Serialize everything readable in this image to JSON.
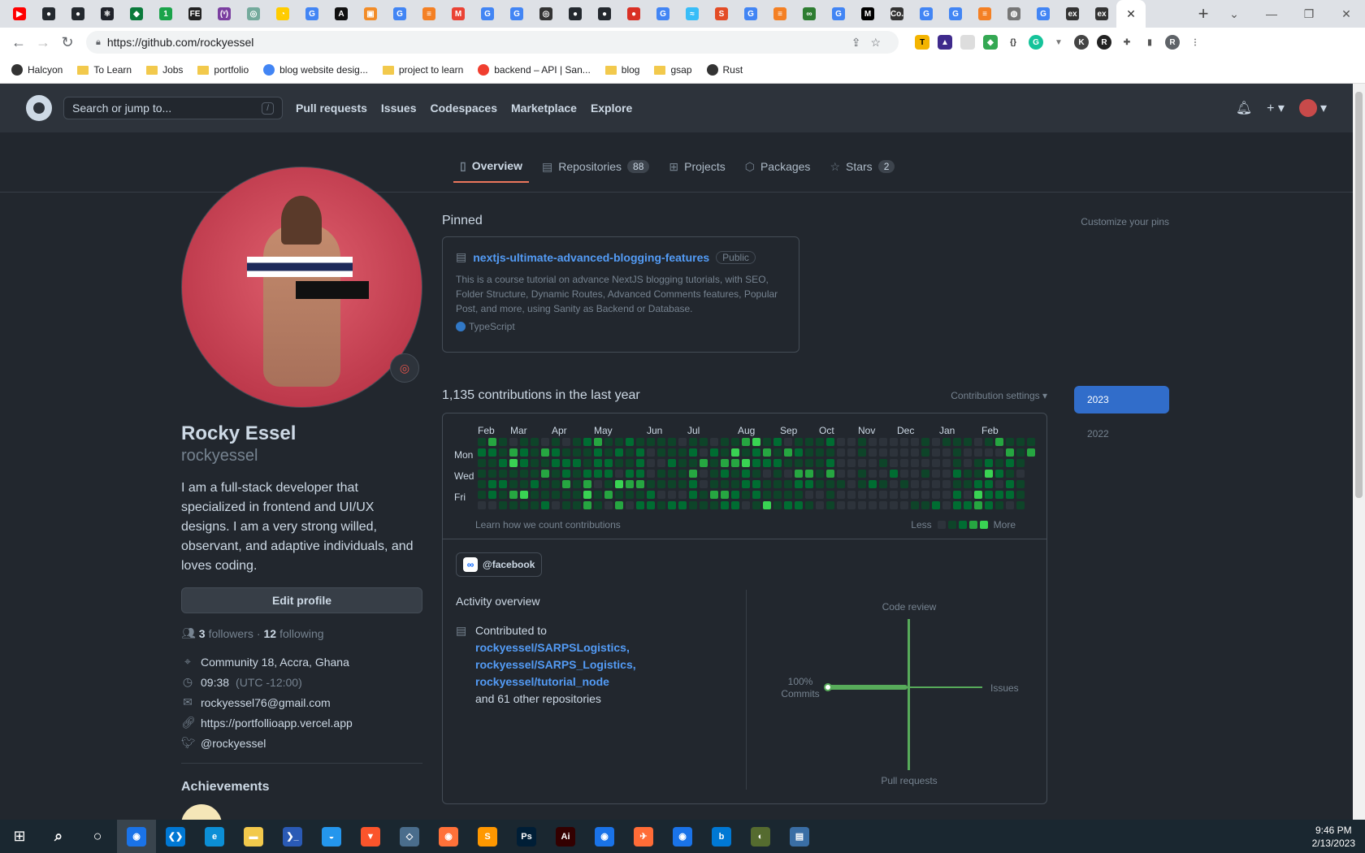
{
  "browser": {
    "url": "https://github.com/rockyessel",
    "tabs": [
      {
        "icon": "youtube-icon",
        "color": "#ff0000",
        "glyph": "▶"
      },
      {
        "icon": "github-icon",
        "color": "#24292f",
        "glyph": "●"
      },
      {
        "icon": "github-icon",
        "color": "#24292f",
        "glyph": "●"
      },
      {
        "icon": "react-icon",
        "color": "#20232a",
        "glyph": "⚛"
      },
      {
        "icon": "leaf-icon",
        "color": "#0b7a3b",
        "glyph": "◆"
      },
      {
        "icon": "one-icon",
        "color": "#1aa34a",
        "glyph": "1"
      },
      {
        "icon": "fe-icon",
        "color": "#222",
        "glyph": "FE"
      },
      {
        "icon": "code-icon",
        "color": "#7b3fa0",
        "glyph": "(ᵛ)"
      },
      {
        "icon": "openai-icon",
        "color": "#74aa9c",
        "glyph": "◎"
      },
      {
        "icon": "pacman-icon",
        "color": "#ffcc00",
        "glyph": "◔"
      },
      {
        "icon": "google-icon",
        "color": "#4285f4",
        "glyph": "G"
      },
      {
        "icon": "a-icon",
        "color": "#111",
        "glyph": "A"
      },
      {
        "icon": "box-icon",
        "color": "#f28c28",
        "glyph": "▣"
      },
      {
        "icon": "google-icon",
        "color": "#4285f4",
        "glyph": "G"
      },
      {
        "icon": "stack-icon",
        "color": "#f48024",
        "glyph": "≡"
      },
      {
        "icon": "gmail-icon",
        "color": "#ea4335",
        "glyph": "M"
      },
      {
        "icon": "google-icon",
        "color": "#4285f4",
        "glyph": "G"
      },
      {
        "icon": "google-icon",
        "color": "#4285f4",
        "glyph": "G"
      },
      {
        "icon": "vercel-icon",
        "color": "#333",
        "glyph": "◎"
      },
      {
        "icon": "github-icon",
        "color": "#24292f",
        "glyph": "●"
      },
      {
        "icon": "github-icon",
        "color": "#24292f",
        "glyph": "●"
      },
      {
        "icon": "badge-icon",
        "color": "#d93025",
        "glyph": "●"
      },
      {
        "icon": "google-icon",
        "color": "#4285f4",
        "glyph": "G"
      },
      {
        "icon": "tailwind-icon",
        "color": "#38bdf8",
        "glyph": "≈"
      },
      {
        "icon": "s-icon",
        "color": "#e34c26",
        "glyph": "S"
      },
      {
        "icon": "google-icon",
        "color": "#4285f4",
        "glyph": "G"
      },
      {
        "icon": "stack-icon",
        "color": "#f48024",
        "glyph": "≡"
      },
      {
        "icon": "infinity-icon",
        "color": "#2e7d32",
        "glyph": "∞"
      },
      {
        "icon": "google-icon",
        "color": "#4285f4",
        "glyph": "G"
      },
      {
        "icon": "medium-icon",
        "color": "#000",
        "glyph": "M"
      },
      {
        "icon": "co-icon",
        "color": "#333",
        "glyph": "Co."
      },
      {
        "icon": "google-icon",
        "color": "#4285f4",
        "glyph": "G"
      },
      {
        "icon": "google-icon",
        "color": "#4285f4",
        "glyph": "G"
      },
      {
        "icon": "stack-icon",
        "color": "#f48024",
        "glyph": "≡"
      },
      {
        "icon": "globe-icon",
        "color": "#777",
        "glyph": "◍"
      },
      {
        "icon": "google-icon",
        "color": "#4285f4",
        "glyph": "G"
      },
      {
        "icon": "ex-icon",
        "color": "#333",
        "glyph": "ex"
      },
      {
        "icon": "ex-icon",
        "color": "#333",
        "glyph": "ex"
      }
    ],
    "active_tab_close": "✕",
    "bookmarks": [
      {
        "label": "Halcyon",
        "icon": "halcyon-icon"
      },
      {
        "label": "To Learn",
        "icon": "folder-icon"
      },
      {
        "label": "Jobs",
        "icon": "folder-icon"
      },
      {
        "label": "portfolio",
        "icon": "folder-icon"
      },
      {
        "label": "blog website desig...",
        "icon": "google-icon"
      },
      {
        "label": "project to learn",
        "icon": "folder-icon"
      },
      {
        "label": "backend – API | San...",
        "icon": "sanity-icon"
      },
      {
        "label": "blog",
        "icon": "folder-icon"
      },
      {
        "label": "gsap",
        "icon": "folder-icon"
      },
      {
        "label": "Rust",
        "icon": "globe-icon"
      }
    ]
  },
  "github": {
    "search_placeholder": "Search or jump to...",
    "search_key": "/",
    "nav": [
      "Pull requests",
      "Issues",
      "Codespaces",
      "Marketplace",
      "Explore"
    ],
    "profile_tabs": [
      {
        "label": "Overview",
        "count": null,
        "icon": "book-icon"
      },
      {
        "label": "Repositories",
        "count": "88",
        "icon": "repo-icon"
      },
      {
        "label": "Projects",
        "count": null,
        "icon": "table-icon"
      },
      {
        "label": "Packages",
        "count": null,
        "icon": "package-icon"
      },
      {
        "label": "Stars",
        "count": "2",
        "icon": "star-icon"
      }
    ],
    "profile": {
      "name": "Rocky Essel",
      "login": "rockyessel",
      "bio": "I am a full-stack developer that specialized in frontend and UI/UX designs. I am a very strong willed, observant, and adaptive individuals, and loves coding.",
      "edit_button": "Edit profile",
      "followers": "3",
      "followers_label": "followers",
      "dot": "·",
      "following": "12",
      "following_label": "following",
      "location": "Community 18, Accra, Ghana",
      "time": "09:38",
      "timezone": "(UTC -12:00)",
      "email": "rockyessel76@gmail.com",
      "website": "https://portfollioapp.vercel.app",
      "twitter": "@rockyessel",
      "achievements_title": "Achievements"
    },
    "pinned": {
      "title": "Pinned",
      "customize": "Customize your pins",
      "repo_name": "nextjs-ultimate-advanced-blogging-features",
      "visibility": "Public",
      "description": "This is a course tutorial on advance NextJS blogging tutorials, with SEO, Folder Structure, Dynamic Routes, Advanced Comments features, Popular Post, and more, using Sanity as Backend or Database.",
      "language": "TypeScript",
      "language_color": "#3178c6"
    },
    "contributions": {
      "title": "1,135 contributions in the last year",
      "settings": "Contribution settings ▾",
      "months": [
        "Feb",
        "Mar",
        "Apr",
        "May",
        "Jun",
        "Jul",
        "Aug",
        "Sep",
        "Oct",
        "Nov",
        "Dec",
        "Jan",
        "Feb"
      ],
      "days": [
        "Mon",
        "Wed",
        "Fri"
      ],
      "learn": "Learn how we count contributions",
      "less": "Less",
      "more": "More",
      "levels": [
        "#2d333b",
        "#0e4429",
        "#006d32",
        "#26a641",
        "#39d353"
      ]
    },
    "activity": {
      "org": "@facebook",
      "title": "Activity overview",
      "contributed_to": "Contributed to",
      "repos": [
        "rockyessel/SARPSLogistics,",
        "rockyessel/SARPS_Logistics,",
        "rockyessel/tutorial_node"
      ],
      "others": "and 61 other repositories",
      "radar": {
        "code_review": "Code review",
        "issues": "Issues",
        "pull_requests": "Pull requests",
        "commits_pct": "100%",
        "commits": "Commits"
      }
    },
    "years": [
      "2023",
      "2022"
    ]
  },
  "taskbar": {
    "apps": [
      {
        "name": "search-icon",
        "color": "transparent",
        "glyph": "⌕"
      },
      {
        "name": "cortana-icon",
        "color": "transparent",
        "glyph": "○"
      },
      {
        "name": "chrome-icon",
        "color": "#1a73e8",
        "glyph": "◉"
      },
      {
        "name": "vscode-icon",
        "color": "#0078d4",
        "glyph": "❮❯"
      },
      {
        "name": "edge-icon",
        "color": "#0c8fd6",
        "glyph": "e"
      },
      {
        "name": "explorer-icon",
        "color": "#f2c94c",
        "glyph": "▬"
      },
      {
        "name": "powershell-icon",
        "color": "#2a5ab5",
        "glyph": "❯_"
      },
      {
        "name": "docker-icon",
        "color": "#2496ed",
        "glyph": "◒"
      },
      {
        "name": "brave-icon",
        "color": "#fb542b",
        "glyph": "▼"
      },
      {
        "name": "cube-icon",
        "color": "#4a6d8c",
        "glyph": "◇"
      },
      {
        "name": "firefox-icon",
        "color": "#ff7139",
        "glyph": "◉"
      },
      {
        "name": "sublime-icon",
        "color": "#ff9800",
        "glyph": "S"
      },
      {
        "name": "photoshop-icon",
        "color": "#001e36",
        "glyph": "Ps"
      },
      {
        "name": "illustrator-icon",
        "color": "#330000",
        "glyph": "Ai"
      },
      {
        "name": "chrome-icon",
        "color": "#1a73e8",
        "glyph": "◉"
      },
      {
        "name": "postman-icon",
        "color": "#ff6c37",
        "glyph": "✈"
      },
      {
        "name": "chrome-icon",
        "color": "#1a73e8",
        "glyph": "◉"
      },
      {
        "name": "bing-icon",
        "color": "#0078d4",
        "glyph": "b"
      },
      {
        "name": "app-icon",
        "color": "#556b2f",
        "glyph": "◐"
      },
      {
        "name": "screen-icon",
        "color": "#3a6ea5",
        "glyph": "▤"
      }
    ],
    "time": "9:46 PM",
    "date": "2/13/2023"
  }
}
